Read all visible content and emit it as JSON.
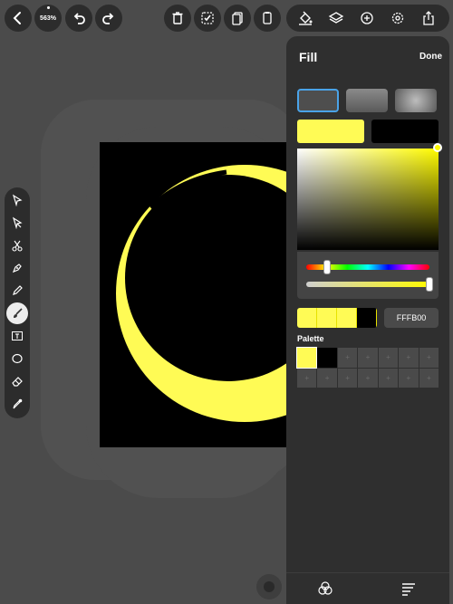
{
  "toolbar": {
    "zoom_label": "563%",
    "left_icons": [
      "back-icon",
      "undo-icon",
      "redo-icon"
    ],
    "center_icons": [
      "trash-icon",
      "select-check-icon",
      "duplicate-icon",
      "paste-icon"
    ],
    "right_icons": [
      "fill-bucket-icon",
      "layers-icon",
      "add-icon",
      "settings-icon",
      "share-icon"
    ]
  },
  "tools": [
    "select-arrow-icon",
    "direct-select-icon",
    "scissors-icon",
    "pen-icon",
    "pencil-icon",
    "brush-icon",
    "text-icon",
    "ellipse-icon",
    "eraser-icon",
    "eyedropper-icon"
  ],
  "active_tool": "brush-icon",
  "artwork": {
    "background": "#000000",
    "shape_color": "#FFFB55"
  },
  "fill_panel": {
    "title": "Fill",
    "done_label": "Done",
    "fill_types": [
      "solid",
      "linear-gradient",
      "radial-gradient"
    ],
    "selected_fill_type": "solid",
    "current_color": "#FFFB55",
    "previous_color": "#000000",
    "hue_position": 0.17,
    "opacity": 1.0,
    "hex_value": "FFFB00",
    "recent_colors": [
      "#FFFB55",
      "#FFFB55",
      "#FFFB55",
      "#000000"
    ],
    "palette_label": "Palette",
    "palette_colors": [
      "#FFFB55",
      "#000000"
    ],
    "palette_empty_symbol": "+",
    "footer_icons": [
      "color-circles-icon",
      "list-lines-icon"
    ]
  }
}
